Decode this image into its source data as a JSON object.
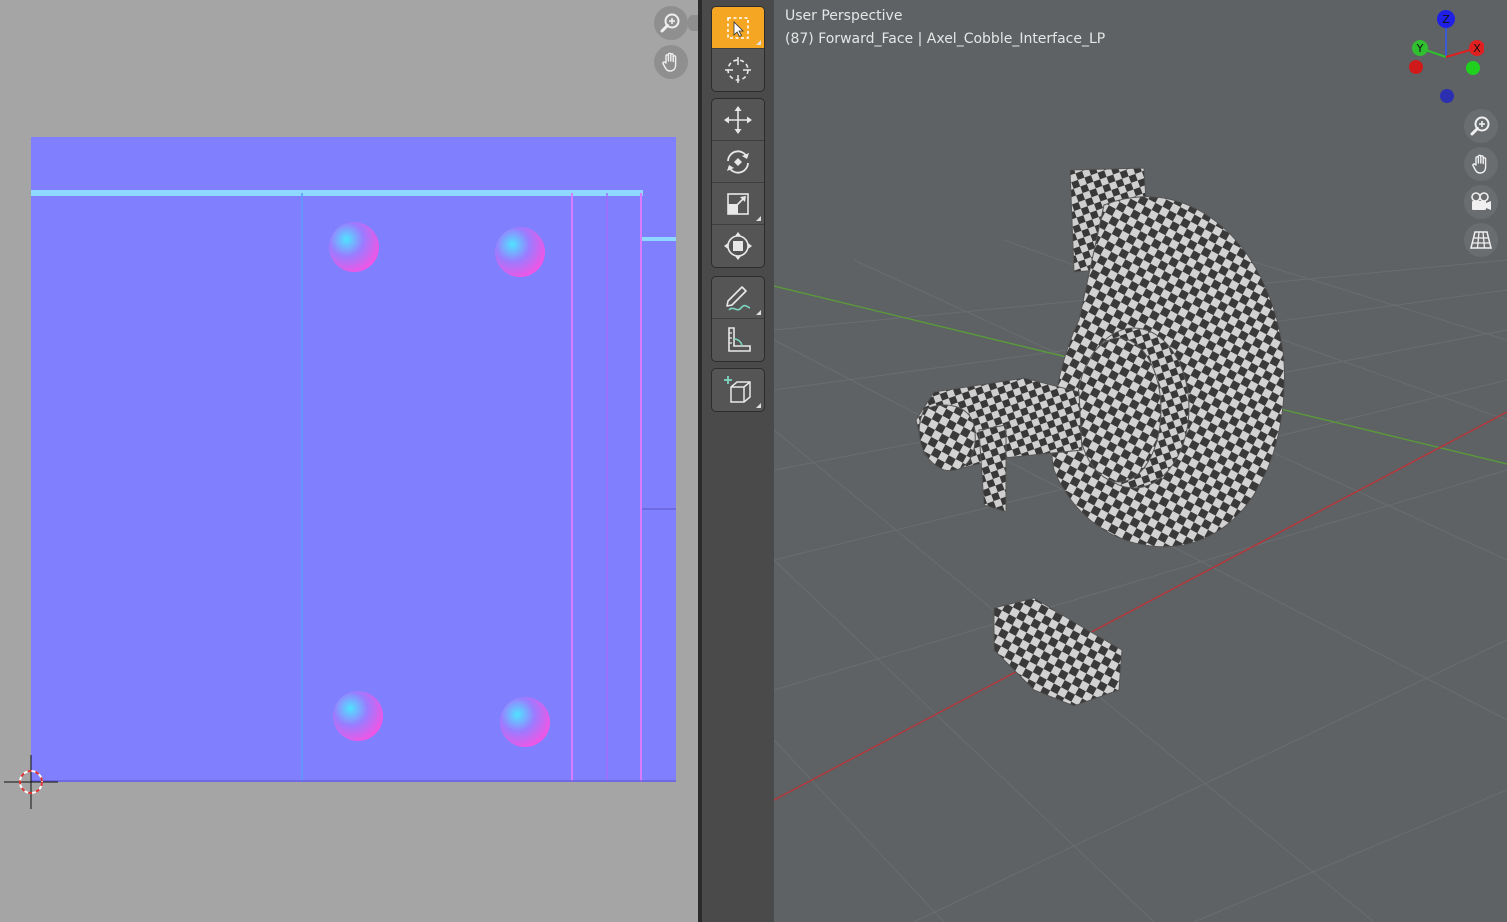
{
  "uv_editor": {
    "nav_tools": [
      "zoom",
      "pan"
    ],
    "image_color": "#8080ff",
    "background_color": "#a5a5a5"
  },
  "toolbar": {
    "groups": [
      [
        {
          "tool": "select-box",
          "active": true
        },
        {
          "tool": "cursor",
          "active": false
        }
      ],
      [
        {
          "tool": "move"
        },
        {
          "tool": "rotate"
        },
        {
          "tool": "scale"
        },
        {
          "tool": "transform"
        }
      ],
      [
        {
          "tool": "annotate"
        },
        {
          "tool": "measure"
        }
      ],
      [
        {
          "tool": "add-cube"
        }
      ]
    ],
    "accent_color": "#f5a623"
  },
  "viewport": {
    "title": "User Perspective",
    "subtitle": "(87) Forward_Face | Axel_Cobble_Interface_LP",
    "gizmo": {
      "z_label": "Z",
      "y_label": "Y",
      "x_label": "X",
      "z_color": "#1f1fe6",
      "y_color": "#2fbf2f",
      "x_color": "#e02020"
    },
    "nav_tools": [
      "zoom",
      "pan",
      "camera",
      "grid"
    ]
  }
}
